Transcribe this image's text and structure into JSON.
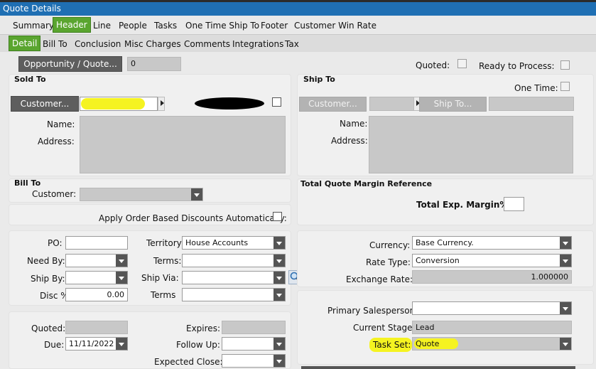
{
  "window": {
    "title": "Quote Details"
  },
  "tabs_main": [
    "Summary",
    "Header",
    "Line",
    "People",
    "Tasks",
    "One Time Ship To",
    "Footer",
    "Customer Win Rate"
  ],
  "tabs_sub": [
    "Detail",
    "Bill To",
    "Conclusion",
    "Misc Charges",
    "Comments",
    "Integrations",
    "Tax"
  ],
  "top": {
    "opportunity_button": "Opportunity / Quote...",
    "opportunity_value": "0",
    "quoted_label": "Quoted:",
    "ready_label": "Ready to Process:"
  },
  "sold_to": {
    "title": "Sold To",
    "customer_button": "Customer...",
    "name_label": "Name:",
    "address_label": "Address:"
  },
  "ship_to": {
    "title": "Ship To",
    "one_time_label": "One Time:",
    "customer_button": "Customer...",
    "ship_to_button": "Ship To...",
    "name_label": "Name:",
    "address_label": "Address:"
  },
  "bill_to": {
    "title": "Bill To",
    "customer_label": "Customer:",
    "apply_discount_label": "Apply Order Based Discounts Automatically:"
  },
  "margin": {
    "title": "Total Quote Margin Reference",
    "label": "Total Exp. Margin% :"
  },
  "order": {
    "po_label": "PO:",
    "need_by_label": "Need By:",
    "ship_by_label": "Ship By:",
    "disc_label": "Disc %",
    "disc_value": "0.00",
    "territory_label": "Territory:",
    "territory_value": "House Accounts",
    "terms_label": "Terms:",
    "ship_via_label": "Ship Via:",
    "terms2_label": "Terms",
    "currency_label": "Currency:",
    "currency_value": "Base Currency.",
    "rate_type_label": "Rate Type:",
    "rate_type_value": "Conversion",
    "exchange_label": "Exchange Rate:",
    "exchange_value": "1.000000"
  },
  "dates": {
    "quoted_label": "Quoted:",
    "due_label": "Due:",
    "due_value": "11/11/2022",
    "expires_label": "Expires:",
    "follow_up_label": "Follow Up:",
    "expected_close_label": "Expected Close:"
  },
  "sales": {
    "primary_label": "Primary Salesperson:",
    "stage_label": "Current Stage:",
    "stage_value": "Lead",
    "task_set_label": "Task Set:",
    "task_set_value": "Quote"
  },
  "colors": {
    "title_bar": "#1f6fb3",
    "active_tab": "#5aa52f",
    "button": "#5e5e5e",
    "highlight": "#f5f321"
  }
}
